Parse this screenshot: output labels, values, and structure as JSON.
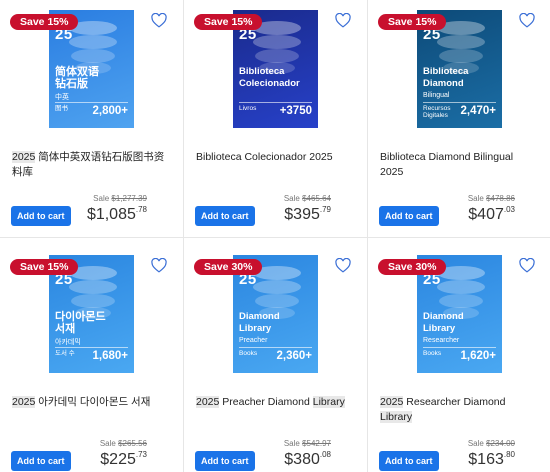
{
  "products": [
    {
      "badge": "Save 15%",
      "cover_year": "20\n25",
      "cover_title": "简体双语\n钻石版",
      "cover_sub": "中英",
      "cover_label": "图书",
      "cover_count": "2,800+",
      "cover_colors": [
        "#2a7de1",
        "#4fa3f0"
      ],
      "title_year": "2025",
      "title_rest": " 简体中英双语钻石版图书资料库",
      "sale_label": "Sale",
      "original_price": "$1,277.39",
      "price_main": "$1,085",
      "price_cents": ".78",
      "button": "Add to cart"
    },
    {
      "badge": "Save 15%",
      "cover_year": "20\n25",
      "cover_title": "Biblioteca\nColecionador",
      "cover_sub": "",
      "cover_label": "Livros",
      "cover_count": "+3750",
      "cover_colors": [
        "#1a2a8c",
        "#2741c9"
      ],
      "title_year": "",
      "title_rest": "Biblioteca Colecionador 2025",
      "sale_label": "Sale",
      "original_price": "$465.64",
      "price_main": "$395",
      "price_cents": ".79",
      "button": "Add to cart"
    },
    {
      "badge": "Save 15%",
      "cover_year": "20\n25",
      "cover_title": "Biblioteca\nDiamond",
      "cover_sub": "Bilingual",
      "cover_label": "Recursos\nDigitales",
      "cover_count": "2,470+",
      "cover_colors": [
        "#0d4a78",
        "#1b6ea6"
      ],
      "title_year": "",
      "title_rest": "Biblioteca Diamond Bilingual 2025",
      "sale_label": "Sale",
      "original_price": "$478.86",
      "price_main": "$407",
      "price_cents": ".03",
      "button": "Add to cart"
    },
    {
      "badge": "Save 15%",
      "cover_year": "20\n25",
      "cover_title": "다이아몬드\n서재",
      "cover_sub": "아카데믹",
      "cover_label": "도서 수",
      "cover_count": "1,680+",
      "cover_colors": [
        "#2b86e0",
        "#4aa8f2"
      ],
      "title_year": "2025",
      "title_rest": " 아카데믹 다이아몬드 서재",
      "sale_label": "Sale",
      "original_price": "$265.56",
      "price_main": "$225",
      "price_cents": ".73",
      "button": "Add to cart"
    },
    {
      "badge": "Save 30%",
      "cover_year": "20\n25",
      "cover_title": "Diamond\nLibrary",
      "cover_sub": "Preacher",
      "cover_label": "Books",
      "cover_count": "2,360+",
      "cover_colors": [
        "#2b86e0",
        "#4aa8f2"
      ],
      "title_year": "2025",
      "title_rest": " Preacher Diamond ",
      "title_hl": "Library",
      "sale_label": "Sale",
      "original_price": "$542.97",
      "price_main": "$380",
      "price_cents": ".08",
      "button": "Add to cart"
    },
    {
      "badge": "Save 30%",
      "cover_year": "20\n25",
      "cover_title": "Diamond\nLibrary",
      "cover_sub": "Researcher",
      "cover_label": "Books",
      "cover_count": "1,620+",
      "cover_colors": [
        "#2b86e0",
        "#4aa8f2"
      ],
      "title_year": "2025",
      "title_rest": " Researcher Diamond ",
      "title_hl": "Library",
      "sale_label": "Sale",
      "original_price": "$234.00",
      "price_main": "$163",
      "price_cents": ".80",
      "button": "Add to cart"
    }
  ],
  "icons": {
    "wishlist": "heart-outline-icon"
  }
}
